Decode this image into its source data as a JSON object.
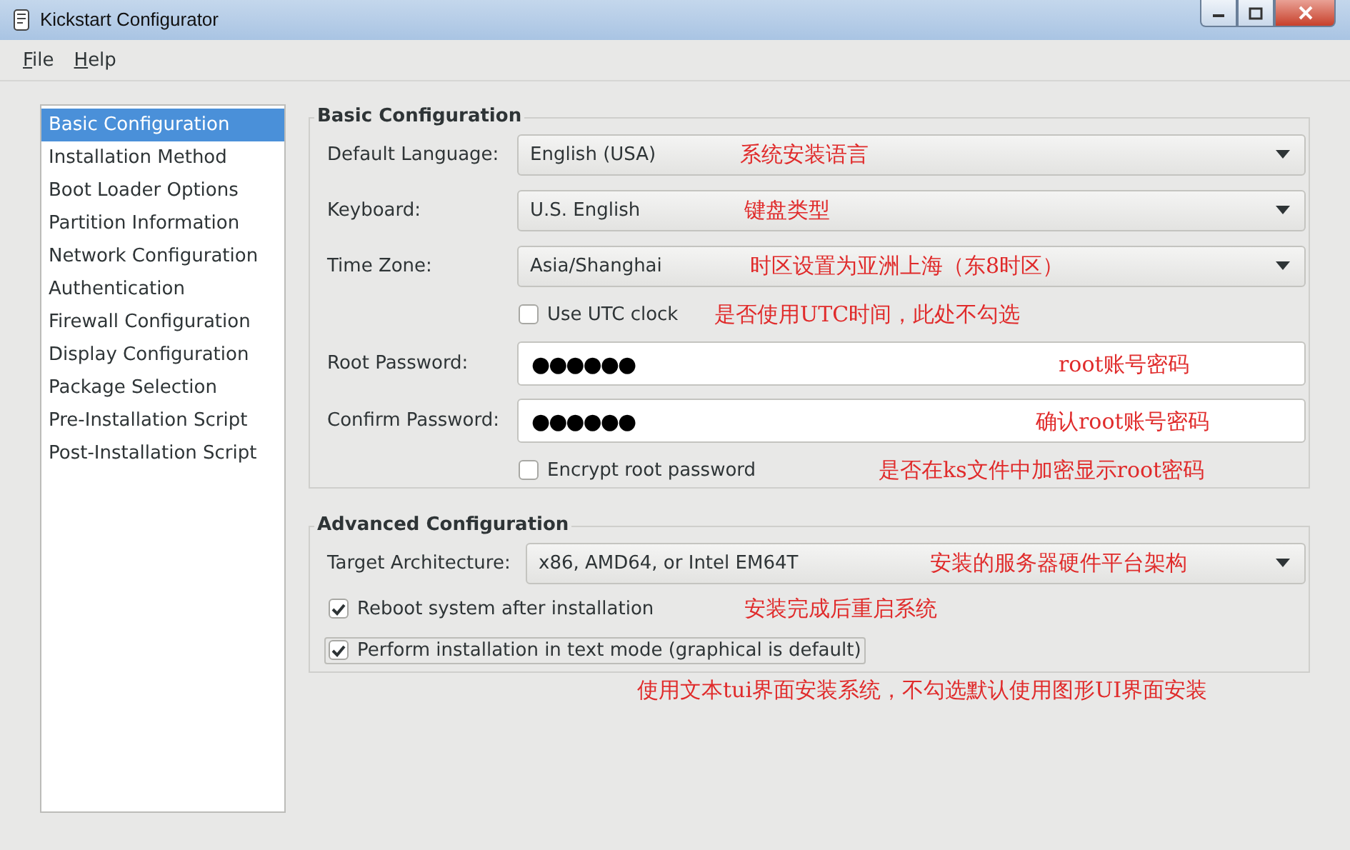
{
  "window": {
    "title": "Kickstart Configurator"
  },
  "menu": [
    {
      "label": "File"
    },
    {
      "label": "Help"
    }
  ],
  "sidebar": {
    "items": [
      {
        "label": "Basic Configuration",
        "selected": true
      },
      {
        "label": "Installation Method",
        "selected": false
      },
      {
        "label": "Boot Loader Options",
        "selected": false
      },
      {
        "label": "Partition Information",
        "selected": false
      },
      {
        "label": "Network Configuration",
        "selected": false
      },
      {
        "label": "Authentication",
        "selected": false
      },
      {
        "label": "Firewall Configuration",
        "selected": false
      },
      {
        "label": "Display Configuration",
        "selected": false
      },
      {
        "label": "Package Selection",
        "selected": false
      },
      {
        "label": "Pre-Installation Script",
        "selected": false
      },
      {
        "label": "Post-Installation Script",
        "selected": false
      }
    ]
  },
  "sections": [
    {
      "title": "Basic Configuration",
      "rows": [
        {
          "kind": "combo",
          "label": "Default Language:",
          "value": "English (USA)",
          "annotation": "系统安装语言"
        },
        {
          "kind": "combo",
          "label": "Keyboard:",
          "value": "U.S. English",
          "annotation": "键盘类型"
        },
        {
          "kind": "combo",
          "label": "Time Zone:",
          "value": "Asia/Shanghai",
          "annotation": "时区设置为亚洲上海（东8时区）"
        },
        {
          "kind": "checkbox",
          "label": "Use UTC clock",
          "checked": false,
          "annotation": "是否使用UTC时间，此处不勾选"
        },
        {
          "kind": "password",
          "label": "Root Password:",
          "value": "●●●●●●",
          "annotation": "root账号密码"
        },
        {
          "kind": "password",
          "label": "Confirm Password:",
          "value": "●●●●●●",
          "annotation": "确认root账号密码"
        },
        {
          "kind": "checkbox",
          "label": "Encrypt root password",
          "checked": false,
          "annotation": "是否在ks文件中加密显示root密码"
        }
      ]
    },
    {
      "title": "Advanced Configuration",
      "rows": [
        {
          "kind": "combo",
          "label": "Target Architecture:",
          "value": "x86, AMD64, or Intel EM64T",
          "annotation": "安装的服务器硬件平台架构"
        },
        {
          "kind": "checkbox",
          "label": "Reboot system after installation",
          "checked": true,
          "annotation": "安装完成后重启系统"
        },
        {
          "kind": "checkbox",
          "label": "Perform installation in text mode (graphical is default)",
          "checked": true,
          "focused": true,
          "annotation": "使用文本tui界面安装系统，不勾选默认使用图形UI界面安装"
        }
      ]
    }
  ]
}
